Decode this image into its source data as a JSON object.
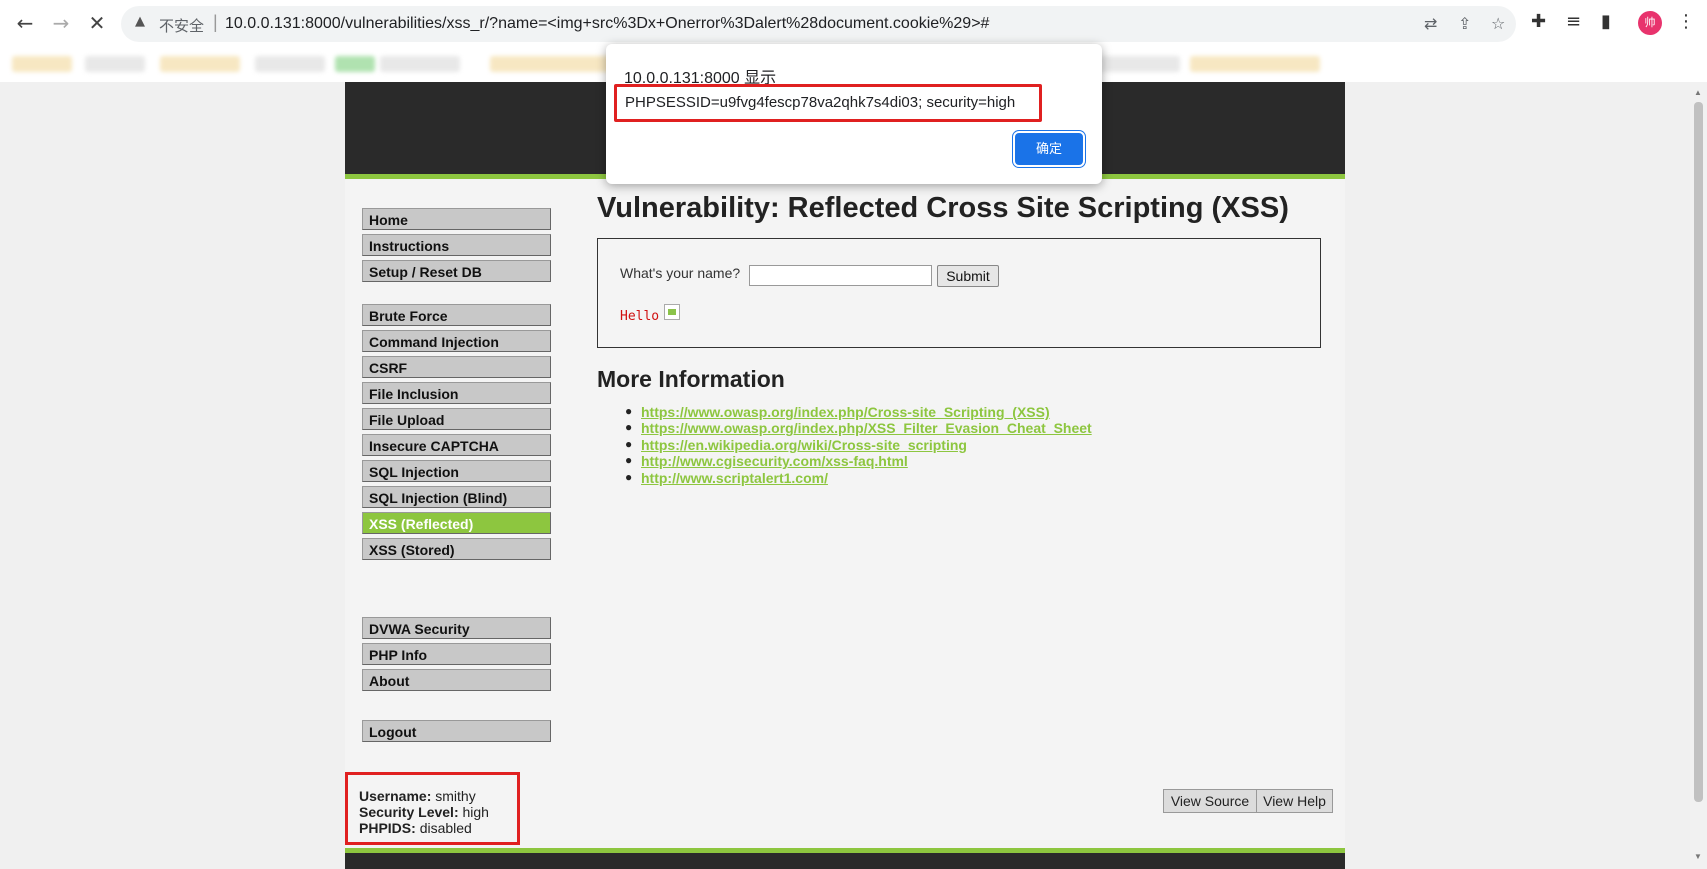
{
  "browser": {
    "back_icon": "arrow-left-icon",
    "forward_icon": "arrow-right-icon",
    "stop_icon": "close-icon",
    "insecure_label": "不安全",
    "url": "10.0.0.131:8000/vulnerabilities/xss_r/?name=<img+src%3Dx+Onerror%3Dalert%28document.cookie%29>#",
    "avatar_text": "帅"
  },
  "alert": {
    "origin": "10.0.0.131:8000 显示",
    "message": "PHPSESSID=u9fvg4fescp78va2qhk7s4di03; security=high",
    "ok_label": "确定",
    "highlight_color": "#e02020"
  },
  "menu": {
    "group1": [
      "Home",
      "Instructions",
      "Setup / Reset DB"
    ],
    "group2": [
      "Brute Force",
      "Command Injection",
      "CSRF",
      "File Inclusion",
      "File Upload",
      "Insecure CAPTCHA",
      "SQL Injection",
      "SQL Injection (Blind)",
      "XSS (Reflected)",
      "XSS (Stored)"
    ],
    "group3": [
      "DVWA Security",
      "PHP Info",
      "About"
    ],
    "group4": [
      "Logout"
    ],
    "selected": "XSS (Reflected)"
  },
  "main": {
    "title": "Vulnerability: Reflected Cross Site Scripting (XSS)",
    "form_label": "What's your name?",
    "input_value": "",
    "submit_label": "Submit",
    "hello_text": "Hello",
    "more_title": "More Information",
    "links": [
      "https://www.owasp.org/index.php/Cross-site_Scripting_(XSS)",
      "https://www.owasp.org/index.php/XSS_Filter_Evasion_Cheat_Sheet",
      "https://en.wikipedia.org/wiki/Cross-site_scripting",
      "http://www.cgisecurity.com/xss-faq.html",
      "http://www.scriptalert1.com/"
    ]
  },
  "footer": {
    "view_source": "View Source",
    "view_help": "View Help",
    "username_label": "Username:",
    "username": "smithy",
    "security_label": "Security Level:",
    "security": "high",
    "phpids_label": "PHPIDS:",
    "phpids": "disabled"
  },
  "colors": {
    "accent_green": "#8dc63f",
    "header_dark": "#2a2a2a",
    "dialog_button": "#1a73e8"
  }
}
